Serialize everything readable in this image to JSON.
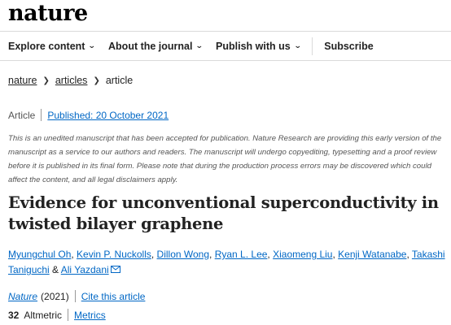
{
  "brand": {
    "logo": "nature"
  },
  "nav": {
    "items": [
      {
        "label": "Explore content"
      },
      {
        "label": "About the journal"
      },
      {
        "label": "Publish with us"
      }
    ],
    "subscribe": "Subscribe"
  },
  "breadcrumb": {
    "items": [
      "nature",
      "articles",
      "article"
    ]
  },
  "meta": {
    "type": "Article",
    "published": "Published: 20 October 2021"
  },
  "notice": "This is an unedited manuscript that has been accepted for publication. Nature Research are providing this early version of the manuscript as a service to our authors and readers. The manuscript will undergo copyediting, typesetting and a proof review before it is published in its final form. Please note that during the production process errors may be discovered which could affect the content, and all legal disclaimers apply.",
  "article": {
    "title": "Evidence for unconventional superconductivity in twisted bilayer graphene",
    "authors": [
      "Myungchul Oh",
      "Kevin P. Nuckolls",
      "Dillon Wong",
      "Ryan L. Lee",
      "Xiaomeng Liu",
      "Kenji Watanabe",
      "Takashi Taniguchi",
      "Ali Yazdani"
    ],
    "and": "&"
  },
  "citation": {
    "journal": "Nature",
    "year": "(2021)",
    "cite_label": "Cite this article"
  },
  "metrics": {
    "altmetric_score": "32",
    "altmetric_label": "Altmetric",
    "metrics_label": "Metrics"
  },
  "colors": {
    "link": "#0067c5",
    "text": "#222222",
    "muted": "#555555"
  }
}
